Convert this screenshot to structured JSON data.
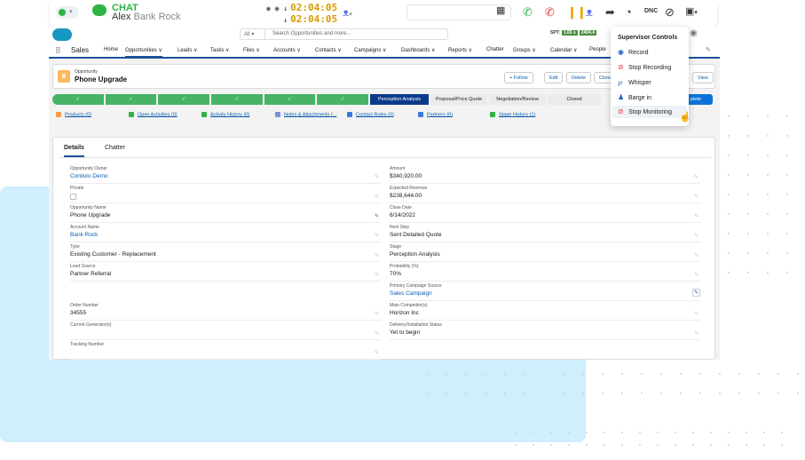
{
  "toolbar": {
    "status_caret": "▾",
    "chat_label": "CHAT",
    "caller_name": "Alex",
    "caller_company": "Bank Rock",
    "timer_call": "02:04:05",
    "timer_wrap": "02:04:05",
    "people_caret": "▾",
    "dnc_label": "DNC",
    "screen_caret": "▾"
  },
  "sf": {
    "app_name": "Sales",
    "search_scope": "All ▾",
    "search_placeholder": "Search Opportunities and more...",
    "spt_label": "SPT:",
    "spt_values": [
      "1.65 s",
      "2404.4"
    ],
    "nav_items": [
      "Home",
      "Opportunities ∨",
      "Leads ∨",
      "Tasks ∨",
      "Files ∨",
      "Accounts ∨",
      "Contacts ∨",
      "Campaigns ∨",
      "Dashboards ∨",
      "Reports ∨",
      "Chatter",
      "Groups ∨",
      "Calendar ∨",
      "People"
    ],
    "record": {
      "type": "Opportunity",
      "name": "Phone Upgrade",
      "buttons": [
        "+ Follow",
        "Edit",
        "Delete",
        "Clone",
        "View"
      ]
    },
    "path": {
      "stages": [
        "✓",
        "✓",
        "✓",
        "✓",
        "✓",
        "✓",
        "Perception Analysis",
        "Proposal/Price Quote",
        "Negotiation/Review",
        "Closed"
      ],
      "current_index": 6,
      "mark_complete": "plete"
    },
    "related": [
      "Products (0)",
      "Open Activities (0)",
      "Activity History (0)",
      "Notes & Attachments (...",
      "Contact Roles (0)",
      "Partners (0)",
      "Stage History (1)"
    ],
    "tabs": [
      "Details",
      "Chatter"
    ],
    "fields_left": [
      {
        "label": "Opportunity Owner",
        "value": "Contivio Demo",
        "link": true
      },
      {
        "label": "Private",
        "value": "",
        "checkbox": true
      },
      {
        "label": "Opportunity Name",
        "value": "Phone Upgrade"
      },
      {
        "label": "Account Name",
        "value": "Bank Rock",
        "link": true
      },
      {
        "label": "Type",
        "value": "Existing Customer - Replacement"
      },
      {
        "label": "Lead Source",
        "value": "Partner Referral"
      },
      {
        "label": "Order Number",
        "value": "34555"
      },
      {
        "label": "Current Generator(s)",
        "value": ""
      },
      {
        "label": "Tracking Number",
        "value": ""
      }
    ],
    "fields_right": [
      {
        "label": "Amount",
        "value": "$340,920.00"
      },
      {
        "label": "Expected Revenue",
        "value": "$238,644.00"
      },
      {
        "label": "Close Date",
        "value": "6/14/2022"
      },
      {
        "label": "Next Step",
        "value": "Sent Detailed Quote"
      },
      {
        "label": "Stage",
        "value": "Perception Analysis"
      },
      {
        "label": "Probability (%)",
        "value": "70%"
      },
      {
        "label": "Primary Campaign Source",
        "value": "Sales Campaign",
        "link": true
      },
      {
        "label": "Main Competitor(s)",
        "value": "Horizon Inc"
      },
      {
        "label": "Delivery/Installation Status",
        "value": "Yet to begin"
      }
    ]
  },
  "supervisor": {
    "title": "Supervisor Controls",
    "items": [
      "Record",
      "Stop Recording",
      "Whisper",
      "Barge in",
      "Stop Monitoring"
    ],
    "hover_index": 4
  },
  "colors": {
    "green": "#2fb344",
    "path_done": "#46b463",
    "path_current": "#0b3a8a",
    "link": "#0b5cab",
    "timer": "#d79a00",
    "red": "#e8393b"
  }
}
